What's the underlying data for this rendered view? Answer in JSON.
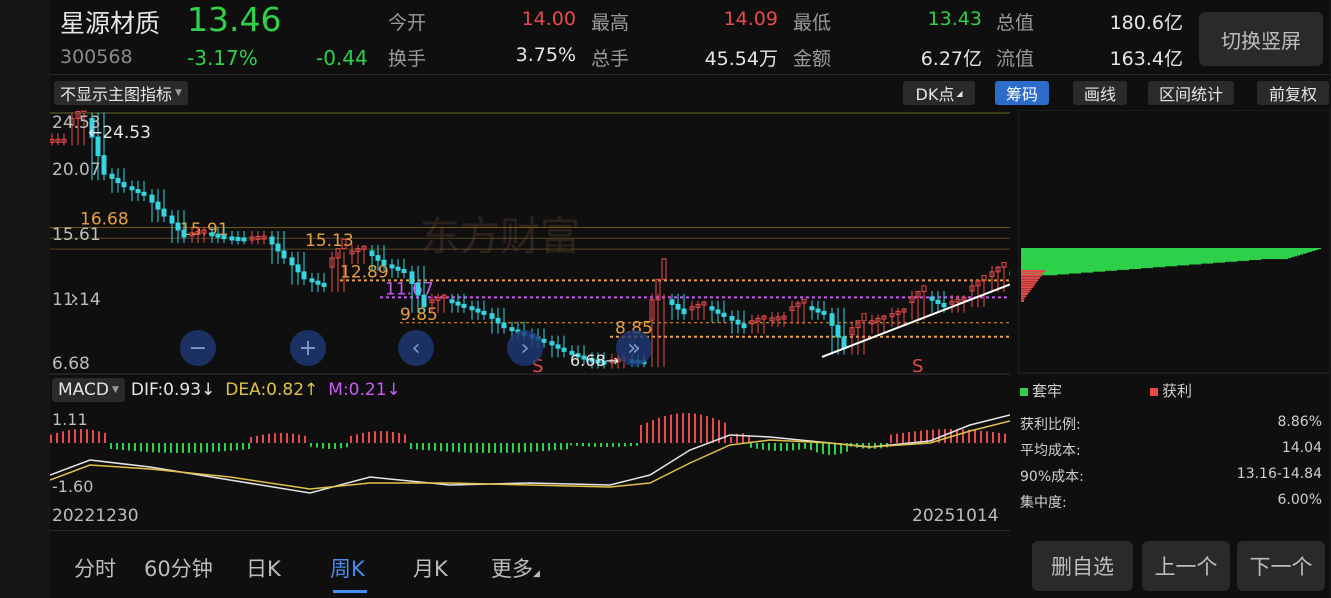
{
  "stock": {
    "name": "星源材质",
    "price": "13.46",
    "code": "300568",
    "change_pct": "-3.17%",
    "change": "-0.44"
  },
  "quote": {
    "open_label": "今开",
    "open": "14.00",
    "high_label": "最高",
    "high": "14.09",
    "low_label": "最低",
    "low": "13.43",
    "mktcap_label": "总值",
    "mktcap": "180.6亿",
    "turnover_label": "换手",
    "turnover": "3.75%",
    "volume_label": "总手",
    "volume": "45.54万",
    "amount_label": "金额",
    "amount": "6.27亿",
    "float_label": "流值",
    "float": "163.4亿"
  },
  "switch_label": "切换竖屏",
  "toolbar": {
    "indicator_dropdown": "不显示主图指标",
    "dk": "DK点",
    "chip": "筹码",
    "draw": "画线",
    "range": "区间统计",
    "adjust": "前复权"
  },
  "main_chart": {
    "y_labels": [
      "24.53",
      "20.07",
      "15.61",
      "11.14",
      "6.68"
    ],
    "high_marker": "24.53",
    "low_marker": "6.68",
    "levels": [
      "16.68",
      "15.91",
      "15.13",
      "12.89",
      "11.67",
      "9.85",
      "8.85"
    ],
    "signals": [
      "S",
      "S",
      "S"
    ],
    "watermark": "东方财富"
  },
  "macd": {
    "dropdown": "MACD",
    "dif": "DIF:0.93↓",
    "dea": "DEA:0.82↑",
    "m": "M:0.21↓",
    "ymax": "1.11",
    "ymin": "-1.60",
    "dif_color": "#e6e6e6",
    "dea_color": "#e0c248",
    "m_color": "#c85cf0"
  },
  "dates": {
    "start": "20221230",
    "end": "20251014"
  },
  "chip": {
    "legend_trapped": "套牢",
    "legend_profit": "获利",
    "profit_ratio_label": "获利比例:",
    "profit_ratio": "8.86%",
    "avg_cost_label": "平均成本:",
    "avg_cost": "14.04",
    "cost90_label": "90%成本:",
    "cost90": "13.16-14.84",
    "concentration_label": "集中度:",
    "concentration": "6.00%"
  },
  "tabs": [
    "分时",
    "60分钟",
    "日K",
    "周K",
    "月K",
    "更多"
  ],
  "active_tab": "周K",
  "bottom_buttons": {
    "remove": "删自选",
    "prev": "上一个",
    "next": "下一个"
  },
  "colors": {
    "up": "#e84b4b",
    "down": "#2fd14a",
    "accent": "#2e6cc9"
  }
}
